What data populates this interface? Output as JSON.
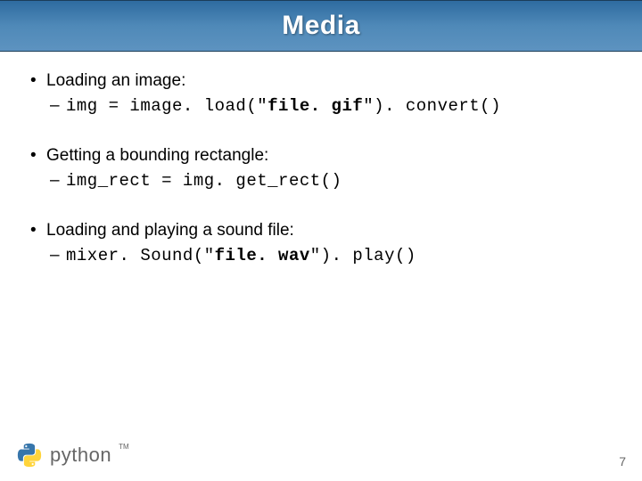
{
  "title": "Media",
  "items": [
    {
      "bullet": "Loading an image:",
      "code_prefix": "img = image. load(\"",
      "code_bold": "file. gif",
      "code_suffix": "\"). convert()"
    },
    {
      "bullet": "Getting a bounding rectangle:",
      "code_prefix": "img_rect = img. get_rect()",
      "code_bold": "",
      "code_suffix": ""
    },
    {
      "bullet": "Loading and playing a sound file:",
      "code_prefix": "mixer. Sound(\"",
      "code_bold": "file. wav",
      "code_suffix": "\"). play()"
    }
  ],
  "logo_text": "python",
  "tm": "TM",
  "page_number": "7"
}
